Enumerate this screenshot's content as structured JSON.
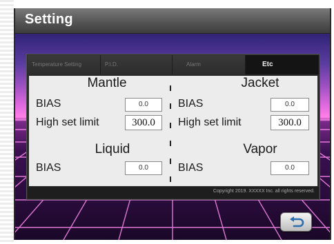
{
  "window": {
    "title": "Setting"
  },
  "tabs": [
    {
      "label": "Temperature Setting",
      "active": false
    },
    {
      "label": "P.I.D.",
      "active": false
    },
    {
      "label": "Alarm",
      "active": false
    },
    {
      "label": "Etc",
      "active": true
    }
  ],
  "sections": {
    "mantle": {
      "title": "Mantle",
      "bias_label": "BIAS",
      "bias_value": "0.0",
      "high_label": "High set limit",
      "high_value": "300.0"
    },
    "jacket": {
      "title": "Jacket",
      "bias_label": "BIAS",
      "bias_value": "0.0",
      "high_label": "High set limit",
      "high_value": "300.0"
    },
    "liquid": {
      "title": "Liquid",
      "bias_label": "BIAS",
      "bias_value": "0.0"
    },
    "vapor": {
      "title": "Vapor",
      "bias_label": "BIAS",
      "bias_value": "0.0"
    }
  },
  "footer": {
    "copyright": "Copyright 2019. XXXXX Inc. all rights reserved."
  },
  "icons": {
    "back": "return-arrow-icon"
  },
  "colors": {
    "title_bar": "#555555",
    "panel_bg": "#ececec",
    "active_tab": "#141414",
    "grid_line": "#ff8cf0",
    "sky_top": "#1c1346",
    "horizon": "#ff7fe8"
  }
}
